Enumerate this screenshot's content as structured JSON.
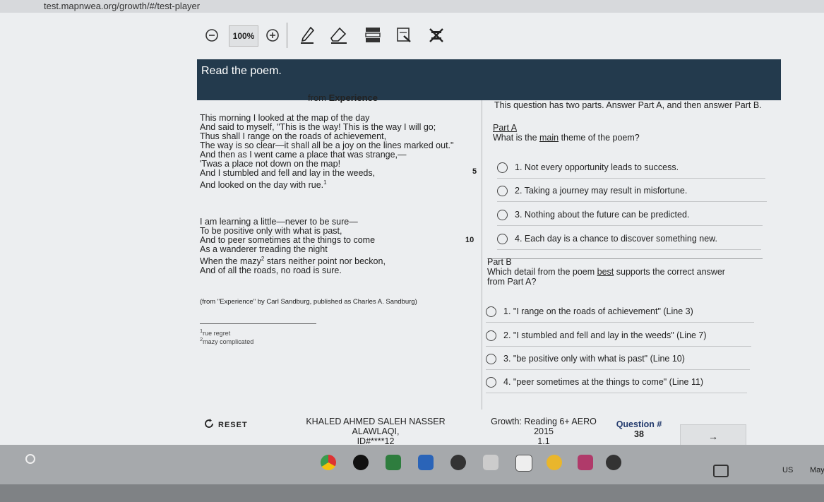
{
  "browser": {
    "url": "test.mapnwea.org/growth/#/test-player"
  },
  "toolbar": {
    "zoom_value": "100%",
    "tools": [
      "zoom-out-icon",
      "zoom-in-icon",
      "pencil-icon",
      "eraser-icon",
      "line-reader-icon",
      "highlighter-icon",
      "answer-eliminator-icon"
    ]
  },
  "banner": {
    "instruction": "Read the poem."
  },
  "passage": {
    "title_prefix": "from ",
    "title": "Experience",
    "stanza1": [
      "This morning I looked at the map of the day",
      "And said to myself, \"This is the way! This is the way I will go;",
      "Thus shall I range on the roads of achievement,",
      "The way is so clear—it shall all be a joy on the lines marked out.\"",
      "And then as I went came a place that was strange,—",
      "'Twas a place not down on the map!",
      "And I stumbled and fell and lay in the weeds,",
      "And looked on the day with rue."
    ],
    "stanza1_sup": "1",
    "stanza2": [
      "I am learning a little—never to be sure—",
      "To be positive only with what is past,",
      "And to peer sometimes at the things to come",
      "As a wanderer treading the night",
      "When the mazy",
      "And of all the roads, no road is sure."
    ],
    "stanza2_line5_rest": " stars neither point nor beckon,",
    "stanza2_sup": "2",
    "line_number_5": "5",
    "line_number_10": "10",
    "credit": "(from \"Experience\" by Carl Sandburg, published as Charles A. Sandburg)",
    "footnotes": [
      {
        "marker": "1",
        "text": "rue  regret"
      },
      {
        "marker": "2",
        "text": "mazy  complicated"
      }
    ]
  },
  "questions": {
    "intro": "This question has two parts. Answer Part A, and then answer Part B.",
    "part_a": {
      "label": "Part A",
      "prompt_before": "What is the ",
      "prompt_emphasis": "main",
      "prompt_after": " theme of the poem?",
      "options": [
        "1.  Not every opportunity leads to success.",
        "2.  Taking a journey may result in misfortune.",
        "3.  Nothing about the future can be predicted.",
        "4.  Each day is a chance to discover something new."
      ]
    },
    "part_b": {
      "label": "Part B",
      "prompt_before": "Which detail from the poem ",
      "prompt_emphasis": "best",
      "prompt_after": " supports the correct answer",
      "prompt_line2": "from Part A?",
      "options": [
        "1.  \"I range on the roads of achievement\" (Line 3)",
        "2.  \"I stumbled and fell and lay in the weeds\" (Line 7)",
        "3.  \"be positive only with what is past\" (Line 10)",
        "4.  \"peer sometimes at the things to come\" (Line 11)"
      ]
    }
  },
  "footer": {
    "reset_label": "RESET",
    "student_name": "KHALED AHMED SALEH NASSER ALAWLAQI,",
    "student_id": "ID#****12",
    "test_name": "Growth: Reading 6+ AERO 2015",
    "test_version": "1.1",
    "question_label": "Question #",
    "question_number": "38",
    "next_symbol": "→"
  },
  "taskbar": {
    "locale": "US",
    "date_partial": "May"
  }
}
